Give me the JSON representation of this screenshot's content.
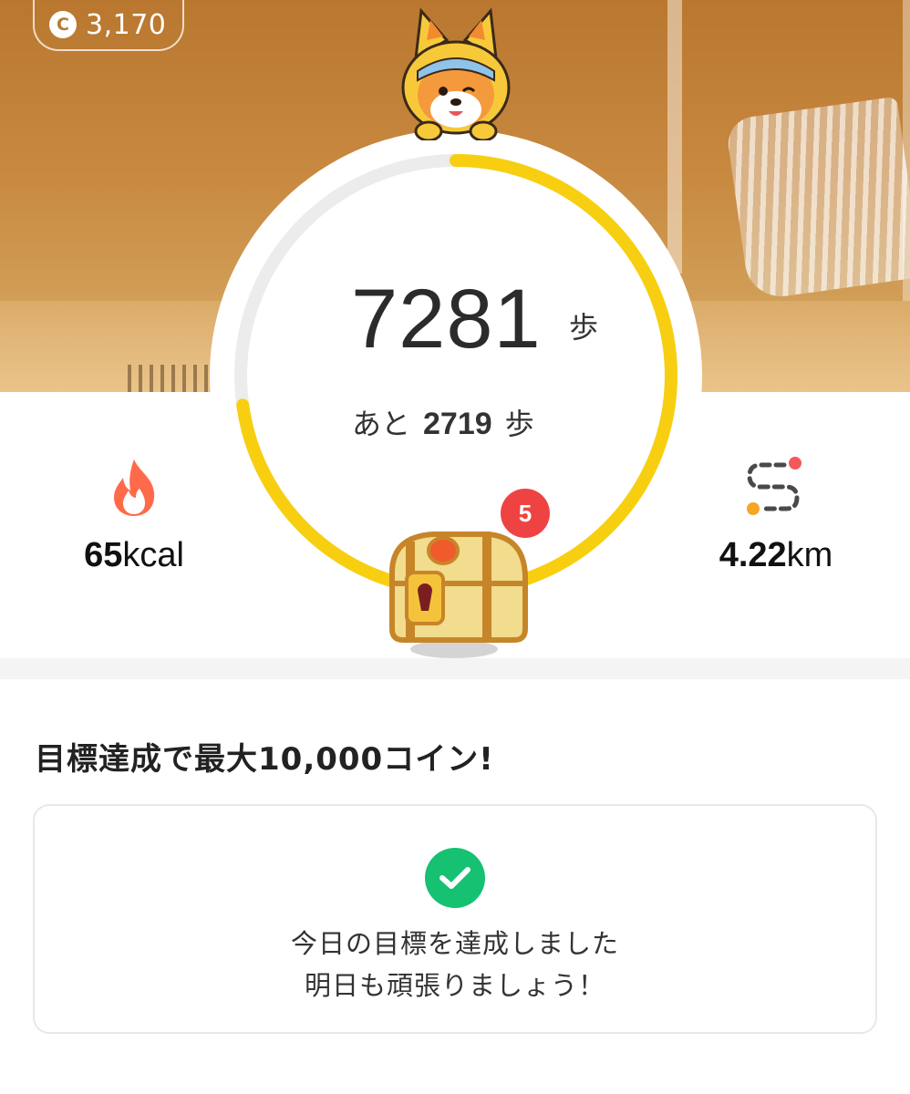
{
  "coins": {
    "value": "3,170",
    "icon": "coin-icon"
  },
  "steps": {
    "count": "7281",
    "unit": "歩",
    "remaining_prefix": "あと",
    "remaining": "2719",
    "remaining_unit": "歩",
    "goal_progress": 0.728
  },
  "colors": {
    "ring": "#f7cf10",
    "track": "#ececec",
    "check": "#16c172",
    "badge": "#ef4343"
  },
  "stats": {
    "calories": {
      "icon": "flame-icon",
      "number": "65",
      "unit": "kcal"
    },
    "distance": {
      "icon": "route-icon",
      "number": "4.22",
      "unit": "km"
    }
  },
  "chest": {
    "badge": "5",
    "icon": "treasure-chest-icon"
  },
  "reward": {
    "headline": "目標達成で最大10,000コイン!",
    "message_line1": "今日の目標を達成しました",
    "message_line2": "明日も頑張りましょう！",
    "icon": "check-circle-icon"
  }
}
